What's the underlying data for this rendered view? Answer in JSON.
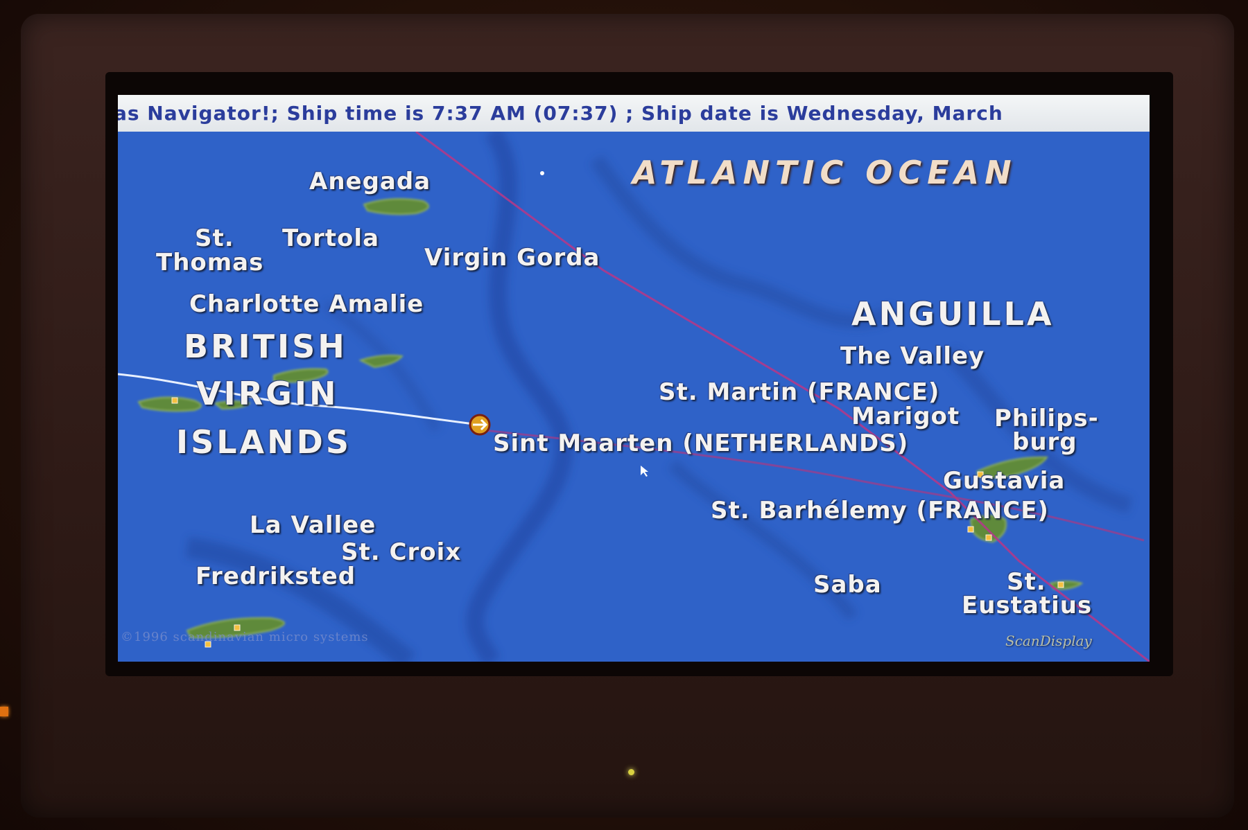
{
  "ticker": {
    "text": "as Navigator!; Ship time is  7:37 AM (07:37)  ; Ship date is Wednesday, March"
  },
  "map": {
    "ocean_label": "ATLANTIC OCEAN",
    "regions": {
      "bvi_line1": "BRITISH",
      "bvi_line2": "VIRGIN",
      "bvi_line3": "ISLANDS",
      "anguilla": "ANGUILLA"
    },
    "places": {
      "anegada": "Anegada",
      "st_thomas_line1": "St.",
      "st_thomas_line2": "Thomas",
      "tortola": "Tortola",
      "virgin_gorda": "Virgin Gorda",
      "charlotte_amalie": "Charlotte Amalie",
      "the_valley": "The Valley",
      "st_martin": "St. Martin (FRANCE)",
      "marigot": "Marigot",
      "philipsburg_line1": "Philips-",
      "philipsburg_line2": "burg",
      "sint_maarten": "Sint Maarten (NETHERLANDS)",
      "gustavia": "Gustavia",
      "st_barthelemy": "St. Barhélemy (FRANCE)",
      "la_vallee": "La Vallee",
      "st_croix": "St. Croix",
      "fredriksted": "Fredriksted",
      "saba": "Saba",
      "st_eustatius_line1": "St.",
      "st_eustatius_line2": "Eustatius"
    },
    "copyright": "©1996 scandinavian micro systems",
    "brand": "ScanDisplay"
  },
  "colors": {
    "sea": "#2f62c8",
    "land": "#5e8a3a",
    "route_track": "#b13a8a",
    "ship_track": "#e8f0ff",
    "ship_marker": "#e0a020",
    "ticker_text": "#2b3d9c"
  },
  "icons": {
    "ship_marker": "ship-position-arrow-icon",
    "cursor": "pointer-cursor-icon"
  }
}
